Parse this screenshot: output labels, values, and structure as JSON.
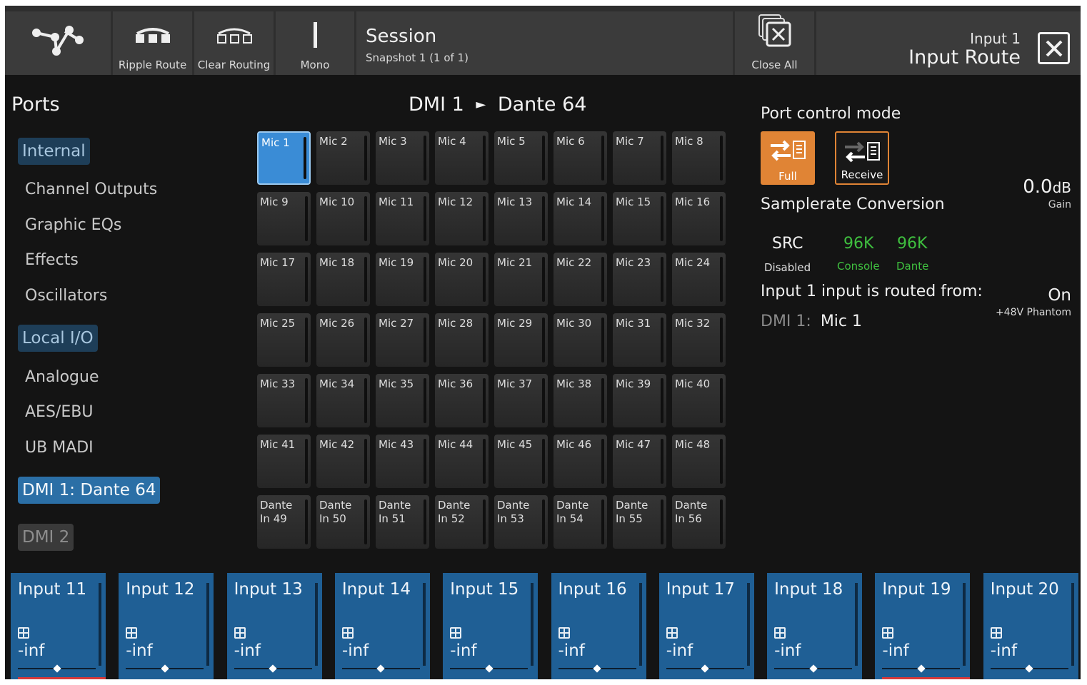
{
  "toolbar": {
    "ripple_route": "Ripple Route",
    "clear_routing": "Clear Routing",
    "mono": "Mono",
    "session_title": "Session",
    "snapshot": "Snapshot 1 (1 of 1)",
    "close_all": "Close All",
    "route_channel": "Input 1",
    "route_title": "Input Route"
  },
  "ports": {
    "title": "Ports",
    "internal": "Internal",
    "internal_items": [
      "Channel Outputs",
      "Graphic EQs",
      "Effects",
      "Oscillators"
    ],
    "local_io": "Local I/O",
    "local_items": [
      "Analogue",
      "AES/EBU",
      "UB MADI"
    ],
    "dmi1": "DMI 1: Dante 64",
    "dmi2": "DMI 2"
  },
  "grid": {
    "title_source": "DMI 1",
    "title_arrow": "►",
    "title_dest": "Dante 64",
    "cells": [
      "Mic 1",
      "Mic 2",
      "Mic 3",
      "Mic 4",
      "Mic 5",
      "Mic 6",
      "Mic 7",
      "Mic 8",
      "Mic 9",
      "Mic 10",
      "Mic 11",
      "Mic 12",
      "Mic 13",
      "Mic 14",
      "Mic 15",
      "Mic 16",
      "Mic 17",
      "Mic 18",
      "Mic 19",
      "Mic 20",
      "Mic 21",
      "Mic 22",
      "Mic 23",
      "Mic 24",
      "Mic 25",
      "Mic 26",
      "Mic 27",
      "Mic 28",
      "Mic 29",
      "Mic 30",
      "Mic 31",
      "Mic 32",
      "Mic 33",
      "Mic 34",
      "Mic 35",
      "Mic 36",
      "Mic 37",
      "Mic 38",
      "Mic 39",
      "Mic 40",
      "Mic 41",
      "Mic 42",
      "Mic 43",
      "Mic 44",
      "Mic 45",
      "Mic 46",
      "Mic 47",
      "Mic 48",
      "Dante\nIn 49",
      "Dante\nIn 50",
      "Dante\nIn 51",
      "Dante\nIn 52",
      "Dante\nIn 53",
      "Dante\nIn 54",
      "Dante\nIn 55",
      "Dante\nIn 56"
    ],
    "selected": "Mic 1"
  },
  "right": {
    "port_control_mode": "Port control mode",
    "mode_full": "Full",
    "mode_receive": "Receive",
    "gain_value": "0.0",
    "gain_unit": "dB",
    "gain_label": "Gain",
    "samplerate_conversion": "Samplerate Conversion",
    "src_label": "SRC",
    "src_state": "Disabled",
    "console_rate": "96K",
    "console_label": "Console",
    "dante_rate": "96K",
    "dante_label": "Dante",
    "routed_from_text": "Input 1 input is routed from:",
    "routed_source": "DMI 1:",
    "routed_port": "Mic 1",
    "phantom_state": "On",
    "phantom_label": "+48V Phantom"
  },
  "strips": [
    {
      "name": "Input 11",
      "level": "-inf"
    },
    {
      "name": "Input 12",
      "level": "-inf"
    },
    {
      "name": "Input 13",
      "level": "-inf"
    },
    {
      "name": "Input 14",
      "level": "-inf"
    },
    {
      "name": "Input 15",
      "level": "-inf"
    },
    {
      "name": "Input 16",
      "level": "-inf"
    },
    {
      "name": "Input 17",
      "level": "-inf"
    },
    {
      "name": "Input 18",
      "level": "-inf"
    },
    {
      "name": "Input 19",
      "level": "-inf"
    },
    {
      "name": "Input 20",
      "level": "-inf"
    }
  ],
  "colors": {
    "accent_orange": "#e08435",
    "selected_blue": "#3a8cd6",
    "strip_blue": "#1f5f95",
    "src_green": "#3fbf3f"
  }
}
